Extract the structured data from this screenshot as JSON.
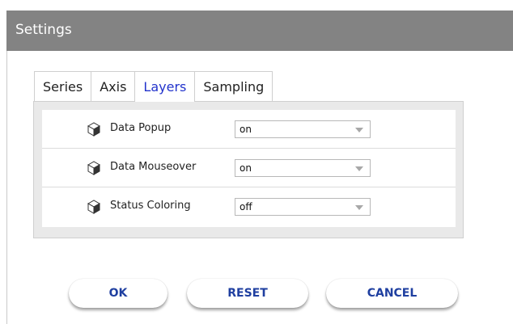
{
  "window": {
    "title": "Settings"
  },
  "tabs": [
    {
      "label": "Series",
      "active": false
    },
    {
      "label": "Axis",
      "active": false
    },
    {
      "label": "Layers",
      "active": true
    },
    {
      "label": "Sampling",
      "active": false
    }
  ],
  "layers": [
    {
      "label": "Data Popup",
      "value": "on",
      "icon": "cube-icon"
    },
    {
      "label": "Data Mouseover",
      "value": "on",
      "icon": "cube-icon"
    },
    {
      "label": "Status Coloring",
      "value": "off",
      "icon": "cube-icon"
    }
  ],
  "buttons": {
    "ok": "OK",
    "reset": "RESET",
    "cancel": "CANCEL"
  },
  "colors": {
    "titlebar": "#838383",
    "active_tab": "#2233cc",
    "button_text": "#1f3fa0"
  }
}
